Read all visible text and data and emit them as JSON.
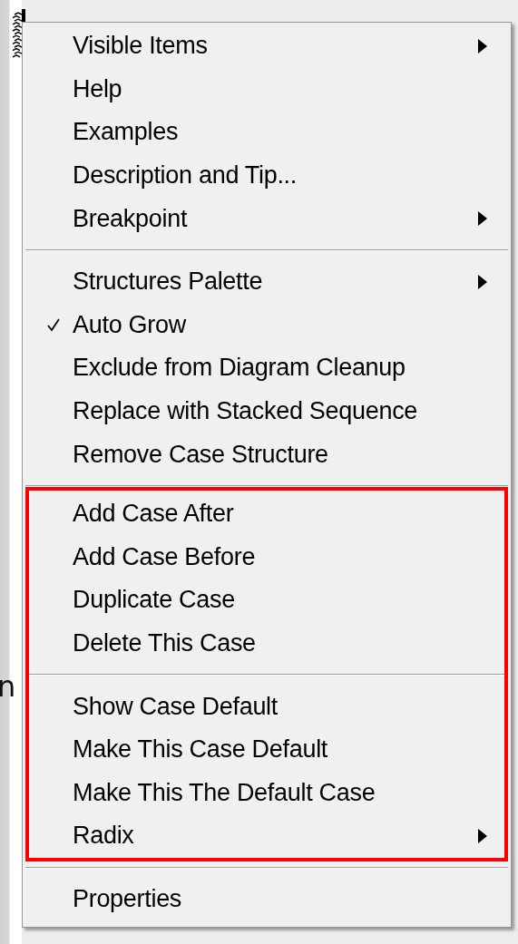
{
  "background_text": "n",
  "menu": {
    "groups": [
      {
        "highlighted": false,
        "items": [
          {
            "label": "Visible Items",
            "checked": false,
            "has_submenu": true
          },
          {
            "label": "Help",
            "checked": false,
            "has_submenu": false
          },
          {
            "label": "Examples",
            "checked": false,
            "has_submenu": false
          },
          {
            "label": "Description and Tip...",
            "checked": false,
            "has_submenu": false
          },
          {
            "label": "Breakpoint",
            "checked": false,
            "has_submenu": true
          }
        ]
      },
      {
        "highlighted": false,
        "items": [
          {
            "label": "Structures Palette",
            "checked": false,
            "has_submenu": true
          },
          {
            "label": "Auto Grow",
            "checked": true,
            "has_submenu": false
          },
          {
            "label": "Exclude from Diagram Cleanup",
            "checked": false,
            "has_submenu": false
          },
          {
            "label": "Replace with Stacked Sequence",
            "checked": false,
            "has_submenu": false
          },
          {
            "label": "Remove Case Structure",
            "checked": false,
            "has_submenu": false
          }
        ]
      },
      {
        "highlighted": true,
        "items": [
          {
            "label": "Add Case After",
            "checked": false,
            "has_submenu": false
          },
          {
            "label": "Add Case Before",
            "checked": false,
            "has_submenu": false
          },
          {
            "label": "Duplicate Case",
            "checked": false,
            "has_submenu": false
          },
          {
            "label": "Delete This Case",
            "checked": false,
            "has_submenu": false
          }
        ]
      },
      {
        "highlighted": true,
        "items": [
          {
            "label": "Show Case Default",
            "checked": false,
            "has_submenu": false
          },
          {
            "label": "Make This Case Default",
            "checked": false,
            "has_submenu": false
          },
          {
            "label": "Make This The Default Case",
            "checked": false,
            "has_submenu": false
          },
          {
            "label": "Radix",
            "checked": false,
            "has_submenu": true
          }
        ]
      },
      {
        "highlighted": false,
        "items": [
          {
            "label": "Properties",
            "checked": false,
            "has_submenu": false
          }
        ]
      }
    ]
  }
}
